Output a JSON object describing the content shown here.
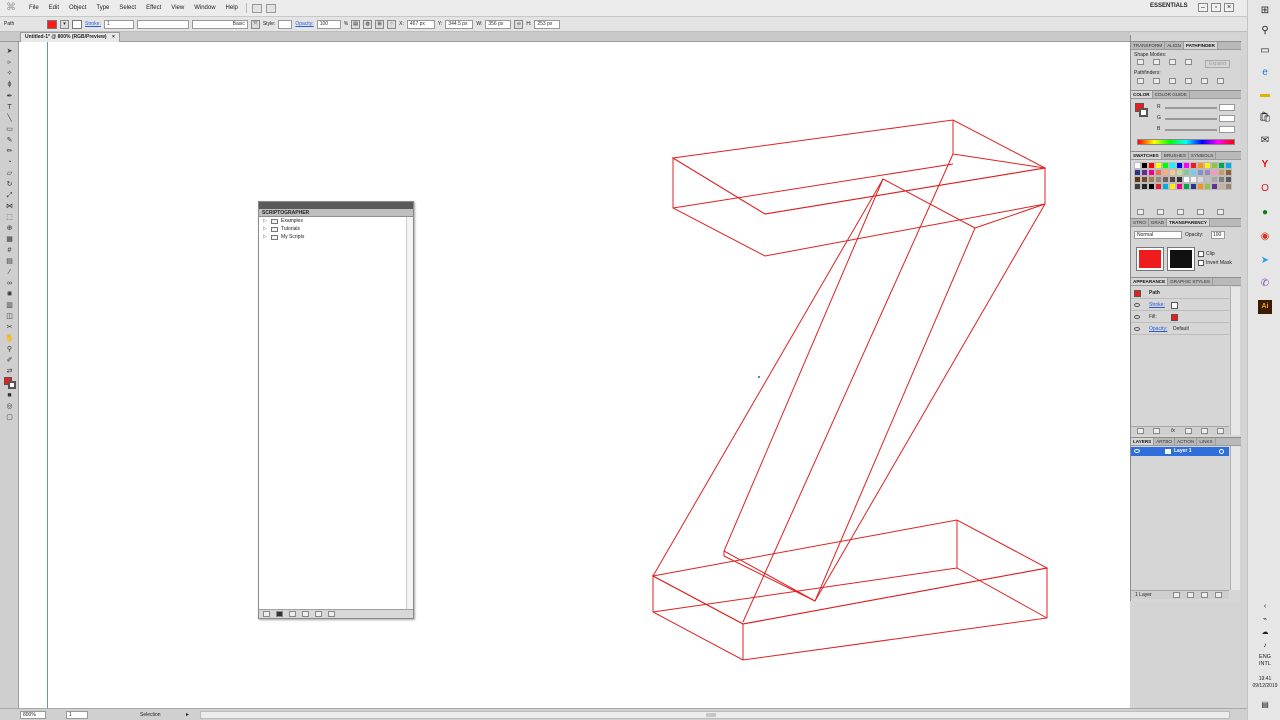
{
  "menubar": {
    "app_icon": "illustrator-icon",
    "items": [
      "File",
      "Edit",
      "Object",
      "Type",
      "Select",
      "Effect",
      "View",
      "Window",
      "Help"
    ],
    "workspace": "ESSENTIALS"
  },
  "control_bar": {
    "selection_type": "Path",
    "fill_color": "#ff1a1a",
    "stroke_label": "Stroke:",
    "stroke_value": "1",
    "brush_label": "Basic",
    "style_label": "Style:",
    "opacity_label": "Opacity:",
    "opacity_value": "100",
    "opacity_unit": "%",
    "x_label": "X:",
    "x_value": "467 px",
    "y_label": "Y:",
    "y_value": "344.5 px",
    "w_label": "W:",
    "w_value": "356 px",
    "h_label": "H:",
    "h_value": "253 px"
  },
  "document_tab": {
    "title": "Untitled-1* @ 800% (RGB/Preview)",
    "close": "×"
  },
  "scriptographer": {
    "title": "SCRIPTOGRAPHER",
    "items": [
      "Examples",
      "Tutorials",
      "My Scripts"
    ]
  },
  "panels": {
    "tabs_top": [
      "TRANSFORM",
      "ALIGN",
      "PATHFINDER"
    ],
    "shape_modes_label": "Shape Modes:",
    "expand_label": "Expand",
    "pathfinders_label": "Pathfinders:",
    "tabs_color": [
      "COLOR",
      "COLOR GUIDE"
    ],
    "color_channels": [
      "R",
      "G",
      "B"
    ],
    "tabs_swatches": [
      "SWATCHES",
      "BRUSHES",
      "SYMBOLS"
    ],
    "tabs_transparency": [
      "STRO",
      "GRAD",
      "TRANSPARENCY"
    ],
    "blend_mode": "Normal",
    "transparency_opacity_label": "Opacity:",
    "transparency_opacity_value": "100",
    "clip_label": "Clip",
    "invert_mask_label": "Invert Mask",
    "tabs_appearance": [
      "APPEARANCE",
      "GRAPHIC STYLES"
    ],
    "appearance_title": "Path",
    "appearance_rows": [
      "Stroke:",
      "Fill:",
      "Opacity:"
    ],
    "appearance_opacity_value": "Default",
    "tabs_layers": [
      "LAYERS",
      "ARTBO",
      "ACTION",
      "LINKS"
    ],
    "layer_name": "Layer 1",
    "layers_count": "1 Layer"
  },
  "status_bar": {
    "zoom": "800%",
    "page": "1",
    "tool": "Selection"
  },
  "taskbar": {
    "icons": [
      "windows-start-icon",
      "search-icon",
      "task-view-icon",
      "edge-icon",
      "file-explorer-icon",
      "store-icon",
      "mail-icon",
      "yandex-icon",
      "opera-icon",
      "xbox-icon",
      "chrome-icon",
      "telegram-icon",
      "viber-icon",
      "illustrator-icon"
    ],
    "lang_line1": "ENG",
    "lang_line2": "INTL",
    "time": "19:41",
    "date": "09/12/2019"
  },
  "colors": {
    "artwork_stroke": "#e02020",
    "accent_blue": "#2f6fdc",
    "fill_red": "#ee1c1c"
  }
}
